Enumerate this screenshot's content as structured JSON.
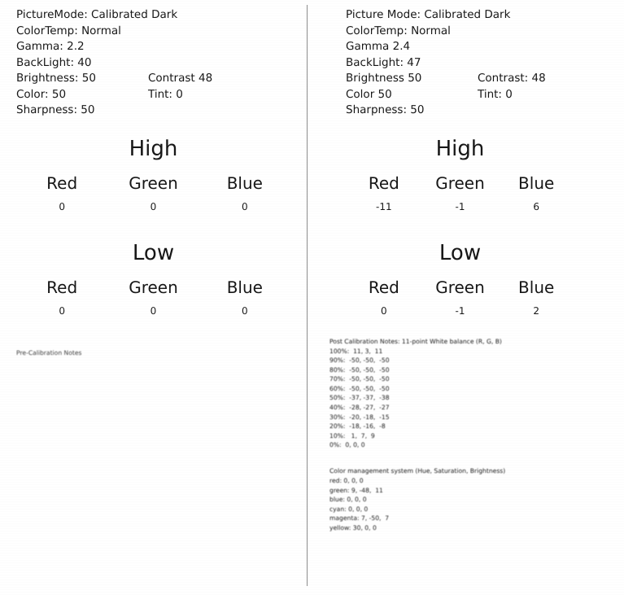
{
  "document": {
    "type": "tv-calibration-settings-comparison",
    "panels": [
      {
        "id": "pre-calibration",
        "settings": {
          "picture_mode_label": "PictureMode: Calibrated Dark",
          "color_temp_label": "ColorTemp: Normal",
          "gamma_label": "Gamma: 2.2",
          "backlight_label": "BackLight: 40",
          "brightness_label": "Brightness: 50",
          "contrast_label": "Contrast  48",
          "color_label": "Color: 50",
          "tint_label": "Tint: 0",
          "sharpness_label": "Sharpness: 50"
        },
        "white_balance": {
          "high_title": "High",
          "low_title": "Low",
          "channels": [
            "Red",
            "Green",
            "Blue"
          ],
          "high_values": [
            "0",
            "0",
            "0"
          ],
          "low_values": [
            "0",
            "0",
            "0"
          ]
        },
        "footnote": "Pre-Calibration Notes"
      },
      {
        "id": "post-calibration",
        "settings": {
          "picture_mode_label": "Picture Mode: Calibrated Dark",
          "color_temp_label": "ColorTemp: Normal",
          "gamma_label": "Gamma  2.4",
          "backlight_label": "BackLight: 47",
          "brightness_label": "Brightness  50",
          "contrast_label": "Contrast: 48",
          "color_label": "Color  50",
          "tint_label": "Tint: 0",
          "sharpness_label": "Sharpness: 50"
        },
        "white_balance": {
          "high_title": "High",
          "low_title": "Low",
          "channels": [
            "Red",
            "Green",
            "Blue"
          ],
          "high_values": [
            "-11",
            "-1",
            "6"
          ],
          "low_values": [
            "0",
            "-1",
            "2"
          ]
        },
        "notes": {
          "wb_title": "Post Calibration Notes: 11-point White balance (R, G, B)",
          "wb_rows": [
            "100%:  11, 3,  11",
            "90%:  -50, -50,  -50",
            "80%:  -50, -50,  -50",
            "70%:  -50, -50,  -50",
            "60%:  -50, -50,  -50",
            "50%:  -37, -37,  -38",
            "40%:  -28, -27,  -27",
            "30%:  -20, -18,  -15",
            "20%:  -18, -16,  -8",
            "10%:   1,  7,  9",
            "0%:  0, 0, 0"
          ],
          "cms_title": "Color management system (Hue, Saturation, Brightness)",
          "cms_rows": [
            "red: 0, 0, 0",
            "green: 9, -48,  11",
            "blue: 0, 0, 0",
            "cyan: 0, 0, 0",
            "magenta: 7, -50,  7",
            "yellow: 30, 0, 0"
          ]
        }
      }
    ]
  }
}
